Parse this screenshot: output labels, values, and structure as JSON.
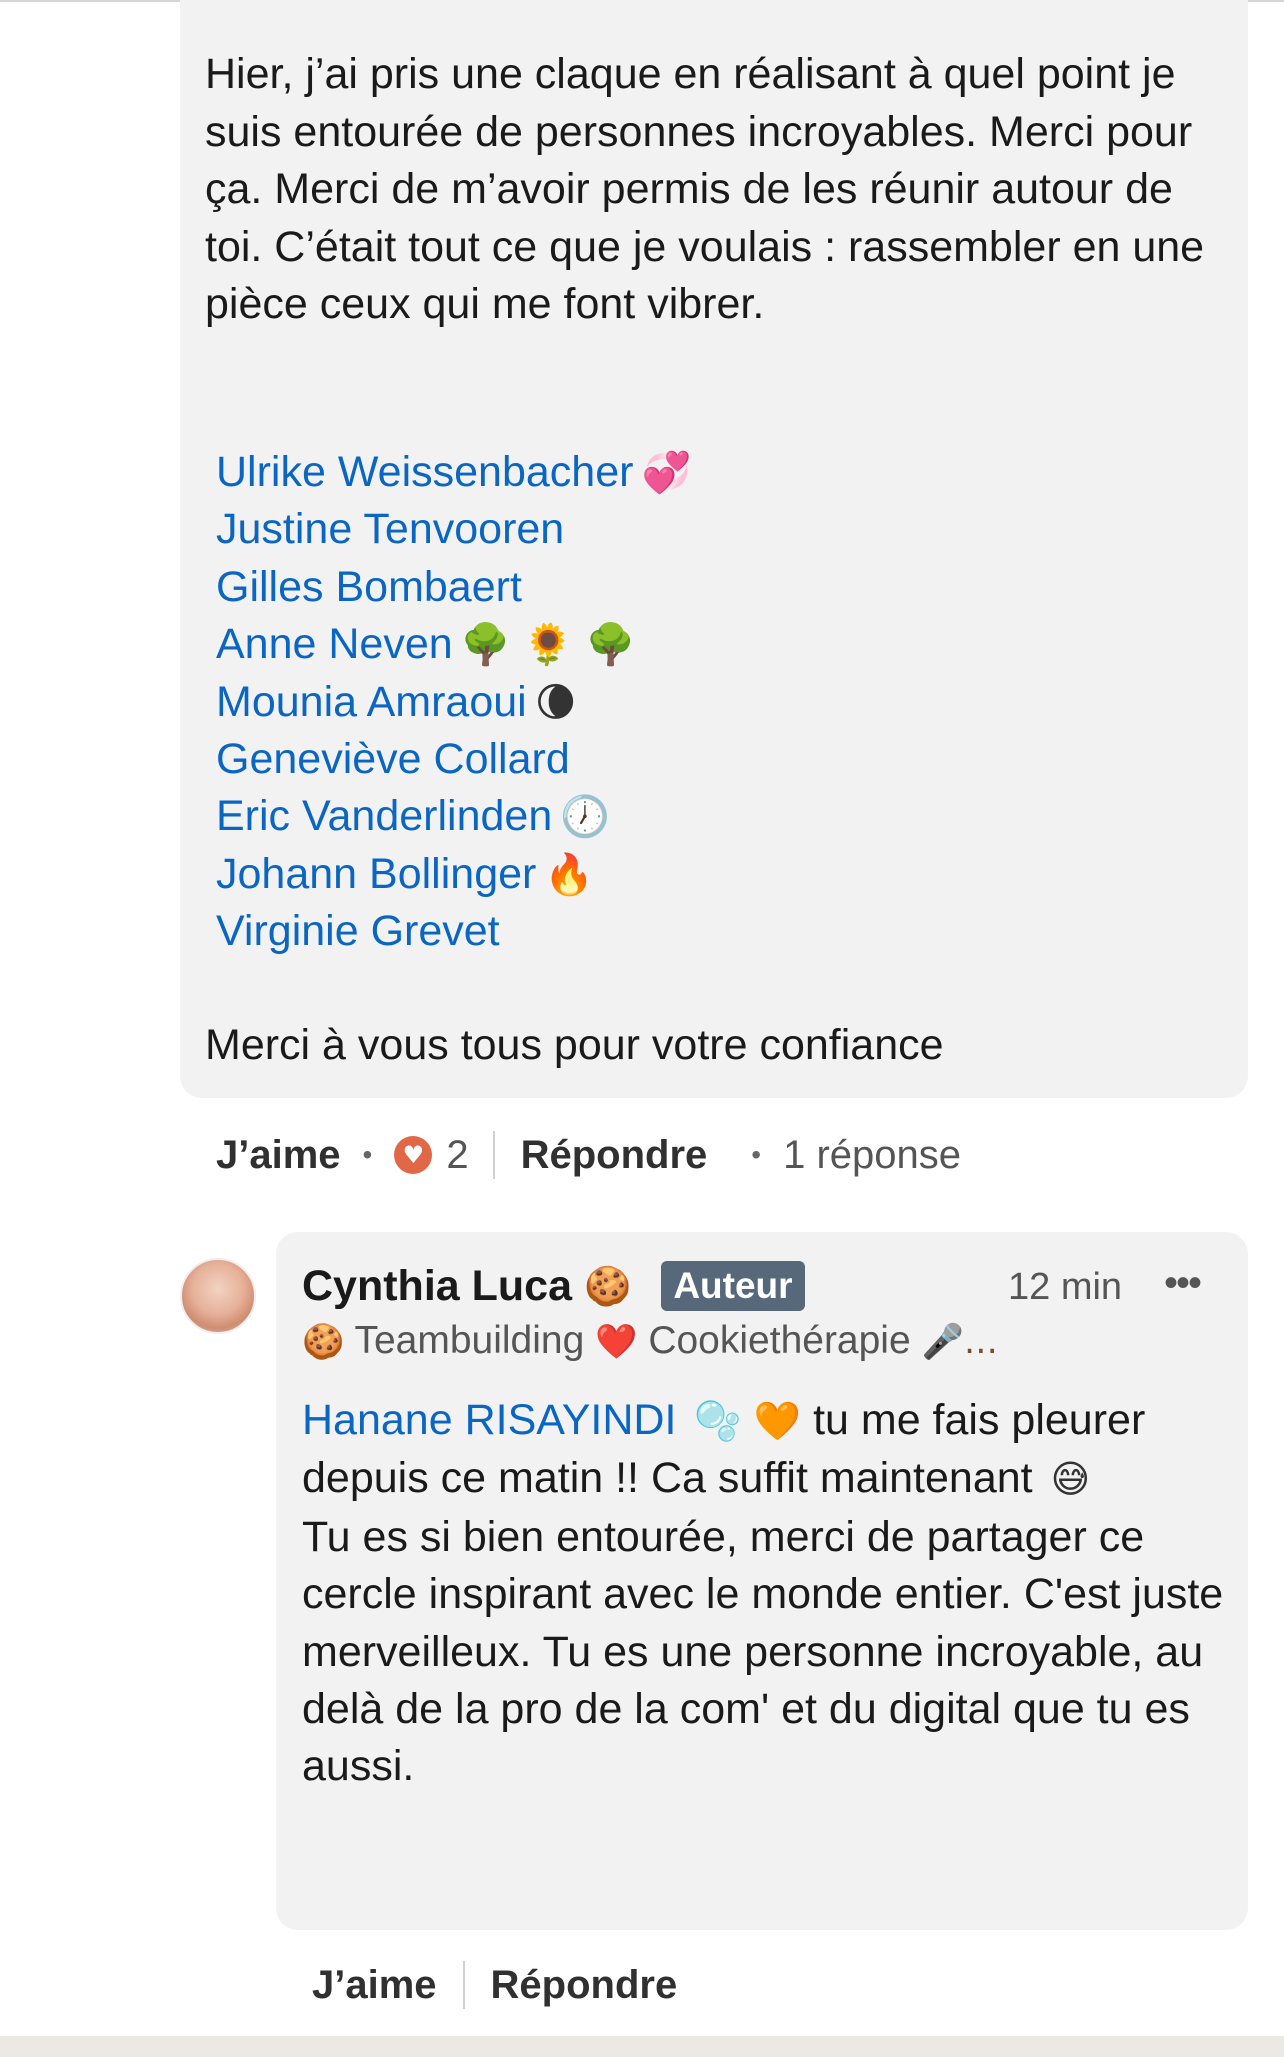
{
  "comment": {
    "text": "Hier, j’ai pris une claque en réalisant à quel point je suis entourée de personnes incroyables. Merci pour ça. Merci de m’avoir permis de les réunir autour de toi. C’était tout ce que je voulais : rassembler en une pièce ceux qui me font vibrer.",
    "mentions": [
      {
        "name": "Ulrike Weissenbacher",
        "emoji": "💞"
      },
      {
        "name": "Justine Tenvooren",
        "emoji": ""
      },
      {
        "name": "Gilles Bombaert",
        "emoji": ""
      },
      {
        "name": "Anne Neven",
        "emoji": "🌳 🌻 🌳"
      },
      {
        "name": "Mounia Amraoui",
        "emoji": "🌘"
      },
      {
        "name": "Geneviève Collard",
        "emoji": ""
      },
      {
        "name": "Eric Vanderlinden",
        "emoji": "🕖"
      },
      {
        "name": "Johann Bollinger",
        "emoji": "🔥"
      },
      {
        "name": "Virginie Grevet",
        "emoji": ""
      }
    ],
    "closing": "Merci à vous tous pour votre confiance",
    "actions": {
      "like_label": "J’aime",
      "reaction_count": "2",
      "reply_label": "Répondre",
      "replies_count": "1 réponse"
    }
  },
  "reply": {
    "author": "Cynthia Luca",
    "author_emoji": "🍪",
    "badge": "Auteur",
    "time": "12 min",
    "more": "•••",
    "headline_prefix_emoji": "🍪",
    "headline_part1": "Teambuilding",
    "headline_heart": "❤️",
    "headline_part2": "Cookiethérapie",
    "headline_suffix": "🎤…",
    "mention": "Hanane RISAYINDI",
    "mention_emoji": "🫧 🧡",
    "line1_rest": "tu me fais pleurer depuis ce matin !! Ca suffit maintenant",
    "line1_emoji": "😅",
    "body": "Tu es si bien entourée, merci de partager ce cercle inspirant avec le monde entier. C'est juste merveilleux. Tu es une personne incroyable, au delà de la pro de la com' et du digital que tu es aussi.",
    "actions": {
      "like_label": "J’aime",
      "reply_label": "Répondre"
    }
  },
  "colors": {
    "link": "#0a66c2",
    "bubble_bg": "#f2f2f2",
    "badge_bg": "#56687a",
    "heart_badge": "#e06847"
  }
}
